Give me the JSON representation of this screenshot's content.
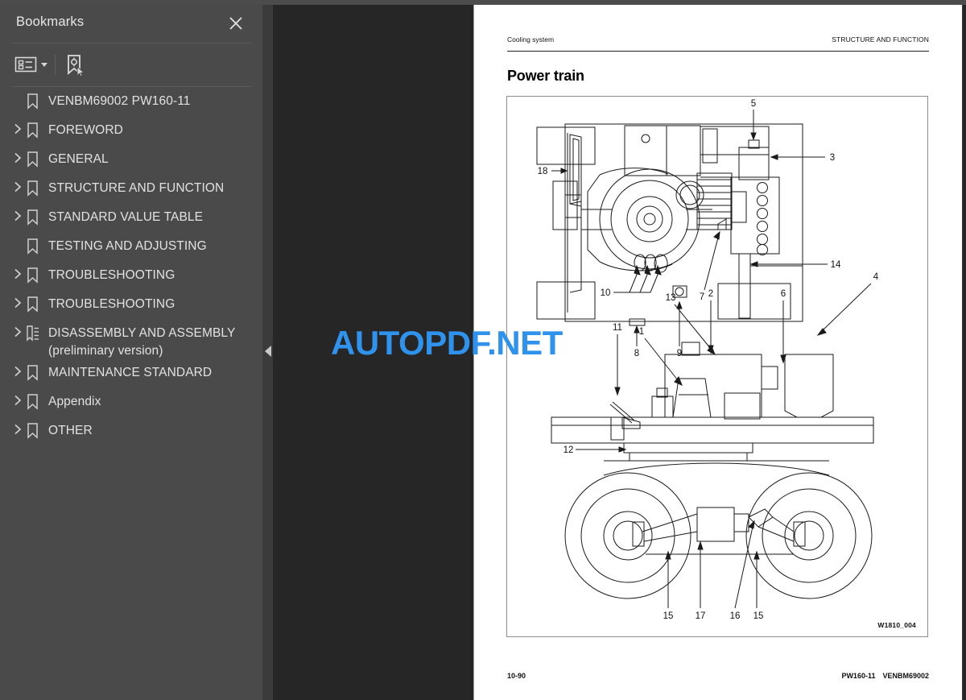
{
  "sidebar": {
    "title": "Bookmarks",
    "close_icon": "close-icon",
    "toolbar": {
      "list_options_icon": "list-options-icon",
      "new_bookmark_icon": "new-bookmark-icon"
    },
    "items": [
      {
        "label": "VENBM69002 PW160-11",
        "expandable": false,
        "icon": "bookmark-icon"
      },
      {
        "label": "FOREWORD",
        "expandable": true,
        "icon": "bookmark-icon"
      },
      {
        "label": "GENERAL",
        "expandable": true,
        "icon": "bookmark-icon"
      },
      {
        "label": "STRUCTURE AND FUNCTION",
        "expandable": true,
        "icon": "bookmark-icon"
      },
      {
        "label": "STANDARD VALUE TABLE",
        "expandable": true,
        "icon": "bookmark-icon"
      },
      {
        "label": "TESTING AND ADJUSTING",
        "expandable": false,
        "icon": "bookmark-icon"
      },
      {
        "label": "TROUBLESHOOTING",
        "expandable": true,
        "icon": "bookmark-icon"
      },
      {
        "label": "TROUBLESHOOTING",
        "expandable": true,
        "icon": "bookmark-icon"
      },
      {
        "label": "DISASSEMBLY AND ASSEMBLY (preliminary version)",
        "expandable": true,
        "icon": "structure-list-icon"
      },
      {
        "label": "MAINTENANCE STANDARD",
        "expandable": true,
        "icon": "bookmark-icon"
      },
      {
        "label": "Appendix",
        "expandable": true,
        "icon": "bookmark-icon"
      },
      {
        "label": "OTHER",
        "expandable": true,
        "icon": "bookmark-icon"
      }
    ],
    "collapse_handle_icon": "collapse-left-icon"
  },
  "document": {
    "header_left": "Cooling system",
    "header_right": "STRUCTURE AND FUNCTION",
    "title": "Power train",
    "figure_id": "W1810_004",
    "footer_left": "10-90",
    "footer_right_model": "PW160-11",
    "footer_right_code": "VENBM69002",
    "callouts_top_view": [
      "18",
      "5",
      "3",
      "14",
      "10",
      "7",
      "8",
      "9"
    ],
    "callouts_side_view": [
      "11",
      "1",
      "13",
      "2",
      "6",
      "4",
      "12",
      "15",
      "17",
      "16",
      "15"
    ]
  },
  "watermark": {
    "text": "AUTOPDF.NET",
    "color": "#2f92ec"
  },
  "colors": {
    "sidebar_bg": "#4a4a4a",
    "viewer_bg": "#262626",
    "page_bg": "#ffffff",
    "top_strip": "#4c4c4c"
  }
}
